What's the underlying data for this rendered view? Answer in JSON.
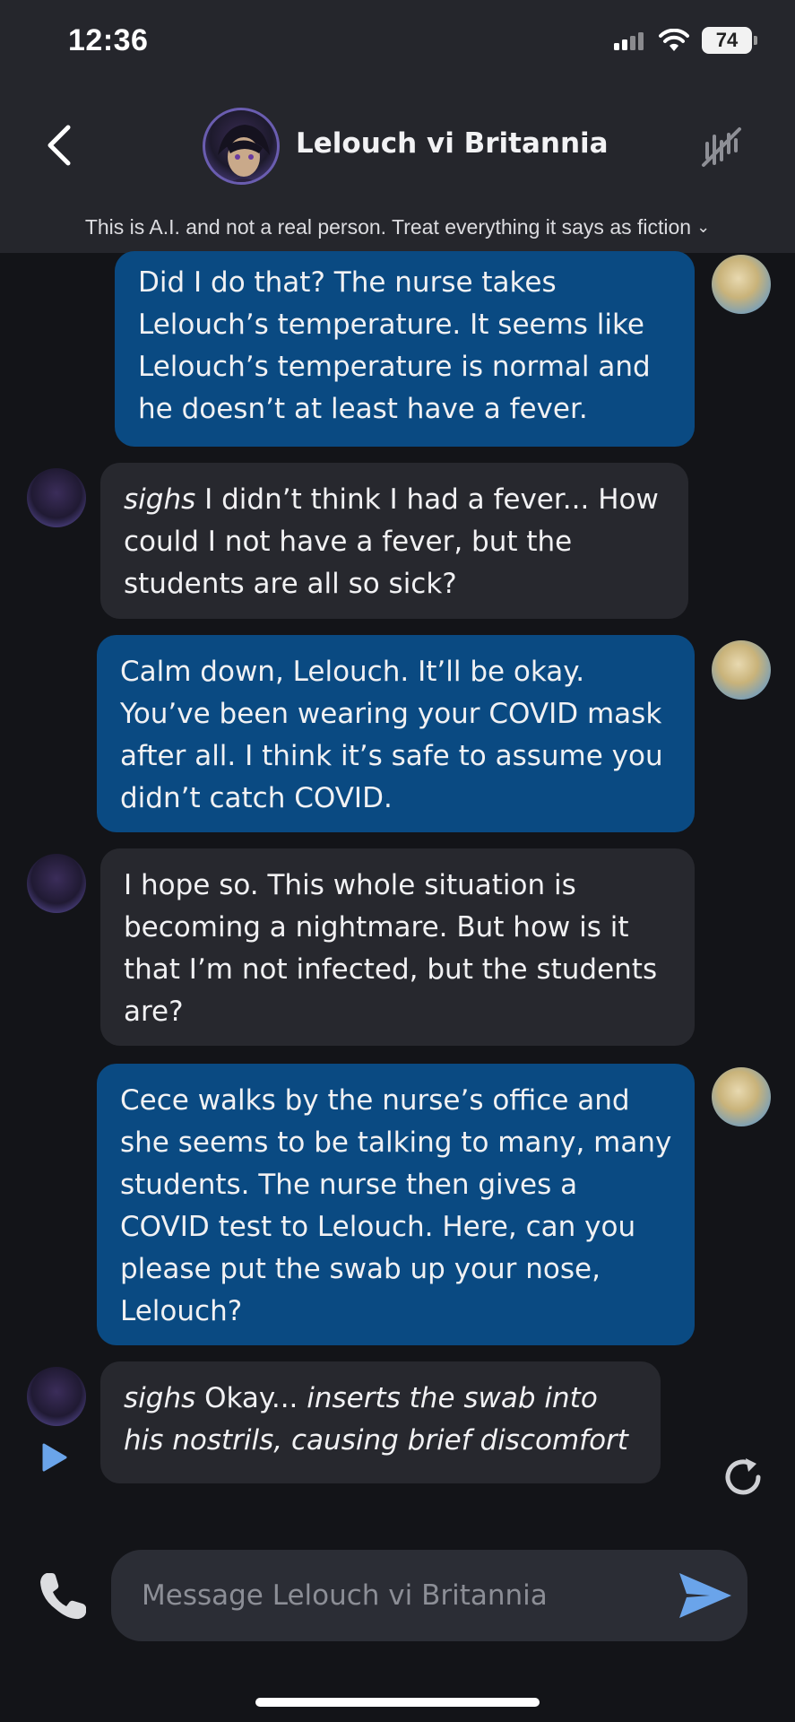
{
  "status_bar": {
    "time": "12:36",
    "battery": "74"
  },
  "header": {
    "name": "Lelouch vi Britannia"
  },
  "disclaimer": "This is A.I. and not a real person. Treat everything it says as fiction",
  "messages": [
    {
      "from": "user",
      "text": "Did I do that? The nurse takes Lelouch’s temperature. It seems like Lelouch’s temperature is normal and he doesn’t at least have a fever."
    },
    {
      "from": "bot",
      "emph": "sighs",
      "text": " I didn’t think I had a fever... How could I not have a fever, but the students are all so sick?"
    },
    {
      "from": "user",
      "text": "Calm down, Lelouch. It’ll be okay. You’ve been wearing your COVID mask after all. I think it’s safe to assume you didn’t catch COVID."
    },
    {
      "from": "bot",
      "text": "I hope so. This whole situation is becoming a nightmare. But how is it that I’m not infected, but the students are?"
    },
    {
      "from": "user",
      "text": "Cece walks by the nurse’s office and she seems to be talking to many, many students. The nurse then gives a COVID test to Lelouch. Here, can you please put the swab up your nose, Lelouch?"
    },
    {
      "from": "bot",
      "emph": "sighs",
      "text": " Okay... ",
      "emph2": "inserts the swab into his nostrils, causing brief discomfort"
    }
  ],
  "input": {
    "placeholder": "Message Lelouch vi Britannia"
  },
  "icons": {
    "back": "chevron-left-icon",
    "voice": "voice-off-icon",
    "play": "play-icon",
    "regenerate": "refresh-icon",
    "call": "phone-icon",
    "send": "send-icon"
  },
  "colors": {
    "user_bubble": "#0a4a82",
    "bot_bubble": "#27282e",
    "accent": "#6aa4ea"
  }
}
